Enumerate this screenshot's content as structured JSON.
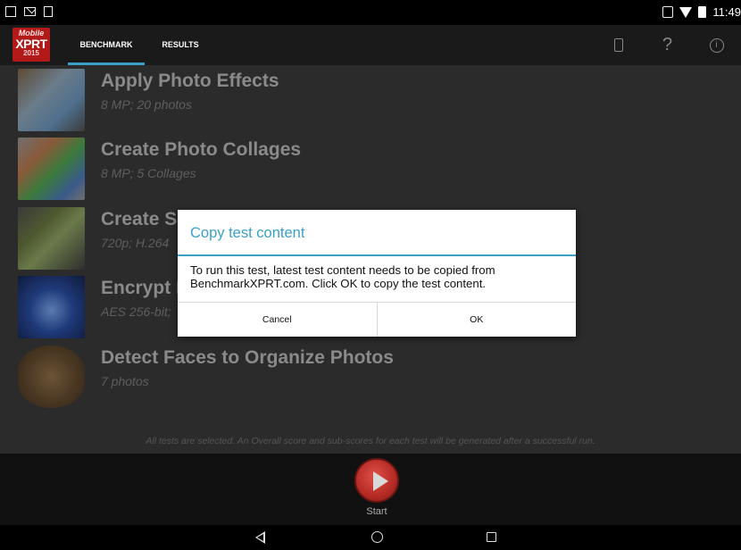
{
  "status_bar": {
    "time": "11:49"
  },
  "app_bar": {
    "logo": {
      "line1": "Mobile",
      "line2": "XPRT",
      "line3": "2015"
    },
    "tabs": [
      {
        "label": "BENCHMARK",
        "active": true
      },
      {
        "label": "RESULTS",
        "active": false
      }
    ],
    "icons": [
      "device-icon",
      "help-icon",
      "info-icon"
    ],
    "help_glyph": "?",
    "info_glyph": "i"
  },
  "tests": [
    {
      "title": "Apply Photo Effects",
      "subtitle": "8 MP; 20 photos"
    },
    {
      "title": "Create Photo Collages",
      "subtitle": "8 MP; 5 Collages"
    },
    {
      "title": "Create S",
      "subtitle": "720p; H.264"
    },
    {
      "title": "Encrypt P",
      "subtitle": "AES 256-bit;"
    },
    {
      "title": "Detect Faces to Organize Photos",
      "subtitle": "7 photos"
    }
  ],
  "footer_note": "All tests are selected. An Overall score and sub-scores for each test will be generated after a successful run.",
  "start": {
    "label": "Start"
  },
  "dialog": {
    "title": "Copy test content",
    "message": "To run this test, latest test content needs to be copied from BenchmarkXPRT.com. Click OK to copy the test content.",
    "cancel_label": "Cancel",
    "ok_label": "OK"
  },
  "colors": {
    "accent": "#3aa0c8",
    "logo_red": "#b21a1a",
    "start_red": "#c0352f"
  }
}
